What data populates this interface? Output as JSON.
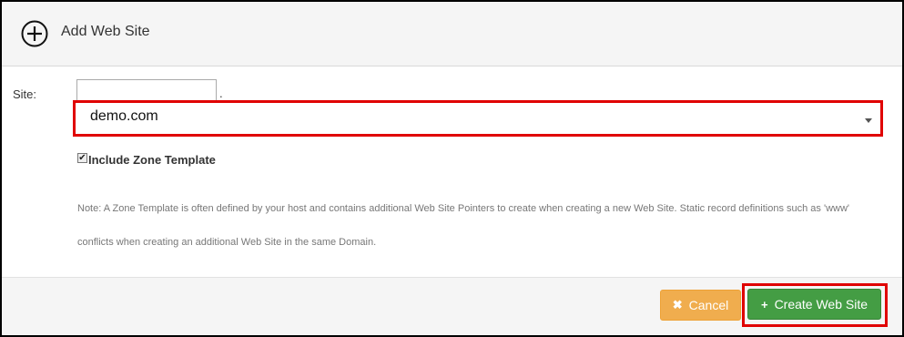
{
  "header": {
    "title": "Add Web Site",
    "icon": "plus-circle-icon"
  },
  "form": {
    "site_label": "Site:",
    "host_value": "",
    "host_separator": ".",
    "domain_selected": "demo.com",
    "include_zone_template": {
      "checked": true,
      "label": "Include Zone Template"
    },
    "note": "Note: A Zone Template is often defined by your host and contains additional Web Site Pointers to create when creating a new Web Site. Static record definitions such as 'www' conflicts when creating an additional Web Site in the same Domain."
  },
  "footer": {
    "cancel_icon": "✖",
    "cancel_label": "Cancel",
    "create_icon": "+",
    "create_label": "Create Web Site"
  },
  "colors": {
    "cancel": "#f0ad4e",
    "create": "#449d44",
    "highlight": "#e00000"
  }
}
